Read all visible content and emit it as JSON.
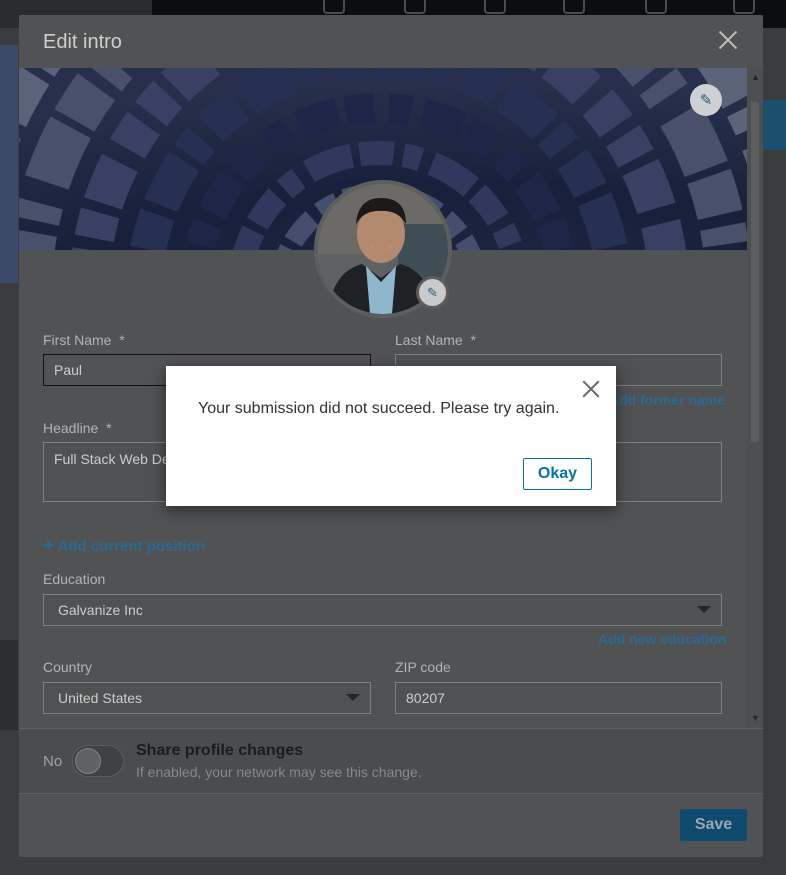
{
  "modal": {
    "title": "Edit intro",
    "first_name_label": "First Name",
    "first_name_value": "Paul",
    "last_name_label": "Last Name",
    "required_marker": "*",
    "add_former_name": "Add former name",
    "headline_label": "Headline",
    "headline_value": "Full Stack Web De",
    "add_current_position": "Add current position",
    "add_current_position_icon": "+",
    "education_label": "Education",
    "education_value": "Galvanize Inc",
    "add_new_education": "Add new education",
    "country_label": "Country",
    "country_value": "United States",
    "zip_label": "ZIP code",
    "zip_value": "80207",
    "share_toggle_state": "No",
    "share_title": "Share profile changes",
    "share_subtitle": "If enabled, your network may see this change.",
    "save_label": "Save"
  },
  "alert": {
    "message": "Your submission did not succeed. Please try again.",
    "okay_label": "Okay"
  },
  "colors": {
    "accent": "#0073b1",
    "overlay": "#505254"
  }
}
